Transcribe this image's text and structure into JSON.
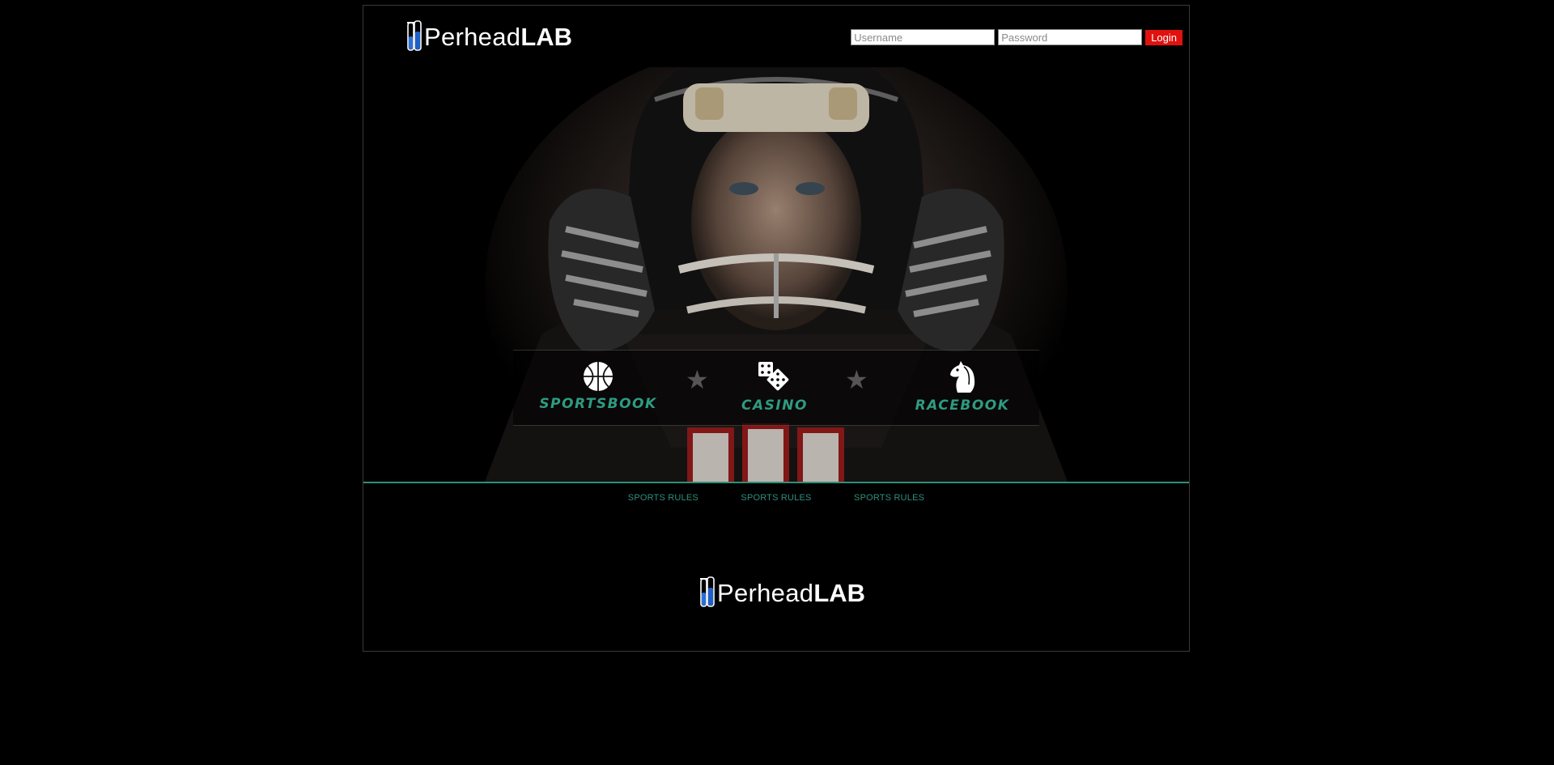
{
  "brand": {
    "name_light": "Perhead",
    "name_bold": "LAB"
  },
  "login": {
    "username_placeholder": "Username",
    "password_placeholder": "Password",
    "button_label": "Login"
  },
  "products": [
    {
      "label": "SPORTSBOOK",
      "icon": "basketball-icon"
    },
    {
      "label": "CASINO",
      "icon": "dice-icon"
    },
    {
      "label": "RACEBOOK",
      "icon": "horse-head-icon"
    }
  ],
  "footer_links": [
    "SPORTS RULES",
    "SPORTS RULES",
    "SPORTS RULES"
  ],
  "colors": {
    "accent": "#2e8f7a",
    "login_button": "#e0110f",
    "background": "#000000"
  }
}
